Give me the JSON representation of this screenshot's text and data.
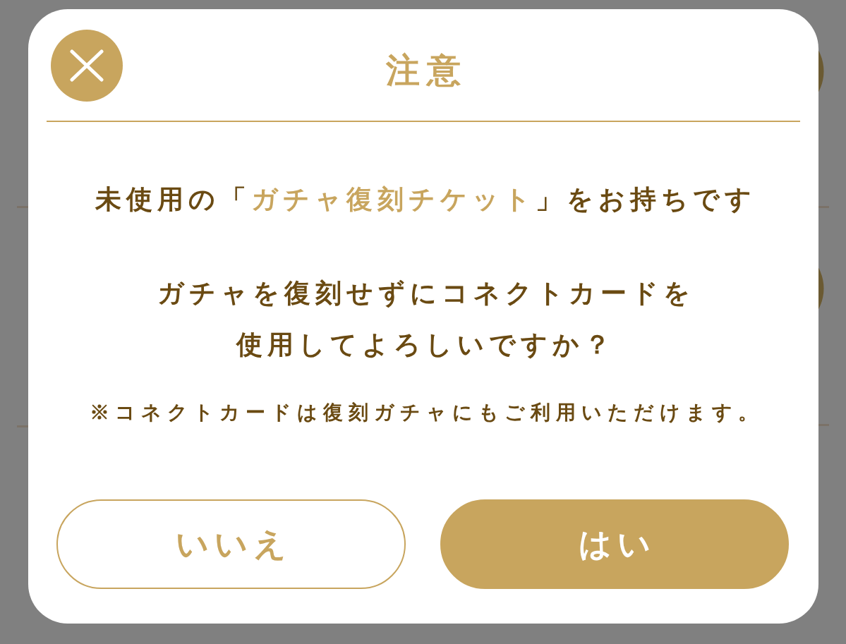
{
  "dialog": {
    "title": "注意",
    "message": [
      {
        "text": "未使用の「",
        "highlight": false
      },
      {
        "text": "ガチャ復刻チケット",
        "highlight": true
      },
      {
        "text": "」をお持ちです",
        "highlight": false
      }
    ],
    "question": [
      "ガチャを復刻せずにコネクトカードを",
      "使用してよろしいですか？"
    ],
    "note": "※コネクトカードは復刻ガチャにもご利用いただけます。",
    "buttons": [
      {
        "label": "いいえ",
        "kind": "secondary"
      },
      {
        "label": "はい",
        "kind": "primary"
      }
    ]
  }
}
